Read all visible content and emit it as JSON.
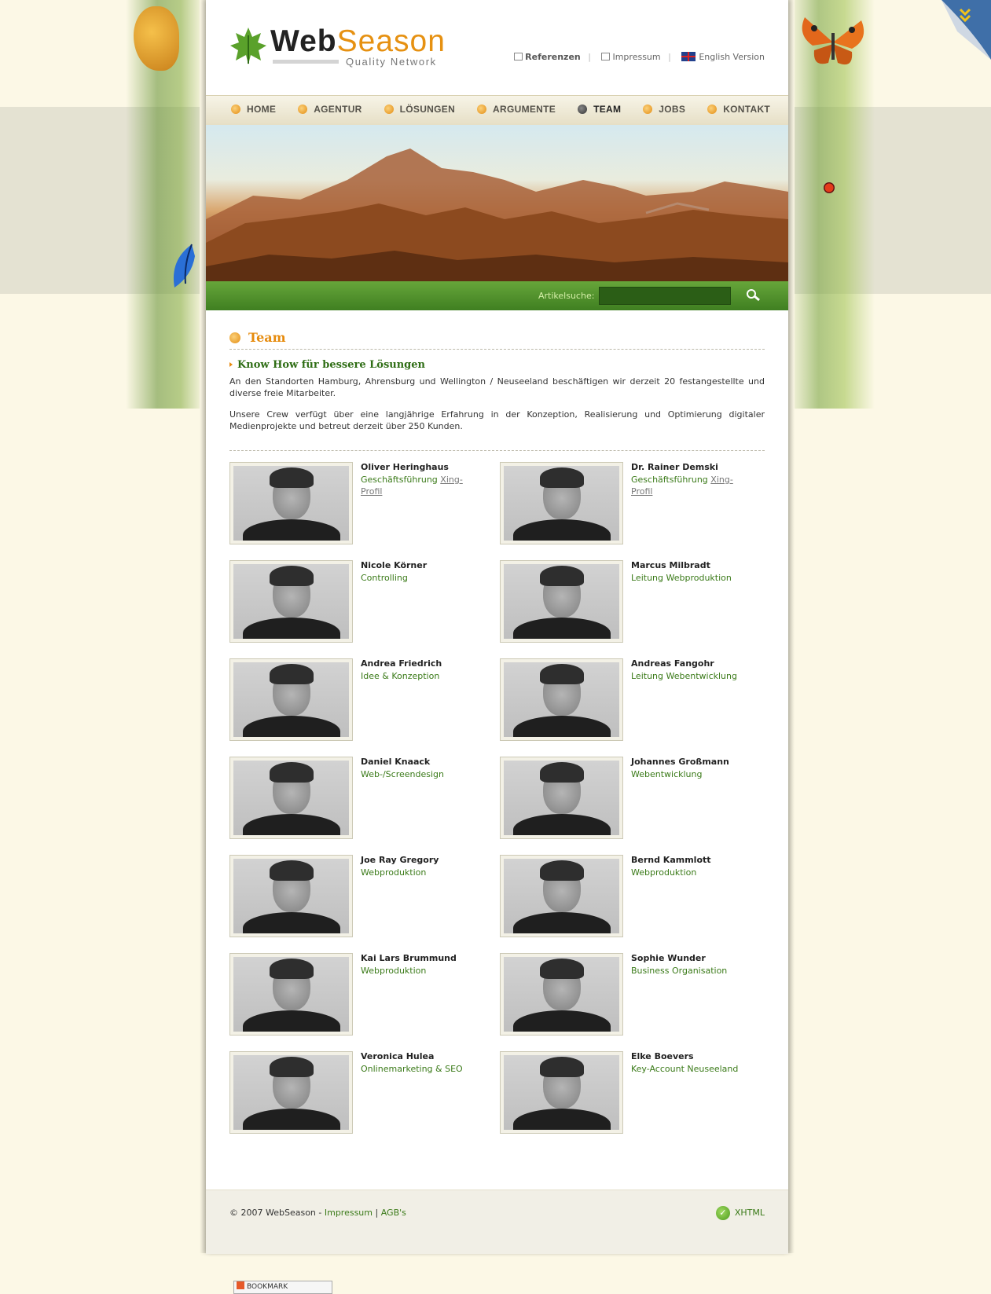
{
  "brand": {
    "name_part1": "Web",
    "name_part2": "Season",
    "tagline": "Quality Network"
  },
  "toplinks": {
    "referenzen": "Referenzen",
    "impressum": "Impressum",
    "english": "English Version"
  },
  "nav": [
    {
      "label": "HOME"
    },
    {
      "label": "AGENTUR"
    },
    {
      "label": "LÖSUNGEN"
    },
    {
      "label": "ARGUMENTE"
    },
    {
      "label": "TEAM",
      "active": true
    },
    {
      "label": "JOBS"
    },
    {
      "label": "KONTAKT"
    }
  ],
  "search": {
    "label": "Artikelsuche:",
    "value": ""
  },
  "content": {
    "heading": "Team",
    "subheading": "Know How für bessere Lösungen",
    "paragraph1": "An den Standorten Hamburg, Ahrensburg und Wellington / Neuseeland beschäftigen wir derzeit 20 festangestellte und diverse freie Mitarbeiter.",
    "paragraph2": "Unsere Crew verfügt über eine langjährige Erfahrung in der Konzeption, Realisierung und Optimierung digitaler Medienprojekte und betreut derzeit über 250 Kunden."
  },
  "team": [
    {
      "name": "Oliver Heringhaus",
      "role": "Geschäftsführung",
      "link": "Xing-Profil"
    },
    {
      "name": "Dr. Rainer Demski",
      "role": "Geschäftsführung",
      "link": "Xing-Profil"
    },
    {
      "name": "Nicole Körner",
      "role": "Controlling"
    },
    {
      "name": "Marcus Milbradt",
      "role": "Leitung Webproduktion"
    },
    {
      "name": "Andrea Friedrich",
      "role": "Idee & Konzeption"
    },
    {
      "name": "Andreas Fangohr",
      "role": "Leitung Webentwicklung"
    },
    {
      "name": "Daniel Knaack",
      "role": "Web-/Screendesign"
    },
    {
      "name": "Johannes Großmann",
      "role": "Webentwicklung"
    },
    {
      "name": "Joe Ray Gregory",
      "role": "Webproduktion"
    },
    {
      "name": "Bernd Kammlott",
      "role": "Webproduktion"
    },
    {
      "name": "Kai Lars Brummund",
      "role": "Webproduktion"
    },
    {
      "name": "Sophie Wunder",
      "role": "Business Organisation"
    },
    {
      "name": "Veronica Hulea",
      "role": "Onlinemarketing & SEO"
    },
    {
      "name": "Elke Boevers",
      "role": "Key-Account Neuseeland"
    }
  ],
  "bookmark": {
    "label": "BOOKMARK"
  },
  "footer": {
    "copyright": "© 2007 WebSeason -",
    "impressum": "Impressum",
    "sep": "|",
    "agb": "AGB's",
    "xhtml": "XHTML"
  },
  "colors": {
    "accent_orange": "#e68b0d",
    "accent_green": "#3a7a18",
    "nav_bg": "#e6dfc6"
  },
  "icons": {
    "search": "magnifier-icon",
    "nav_bullet": "orange-bullet-icon",
    "flag": "uk-flag-icon",
    "xhtml": "checkmark-icon"
  }
}
